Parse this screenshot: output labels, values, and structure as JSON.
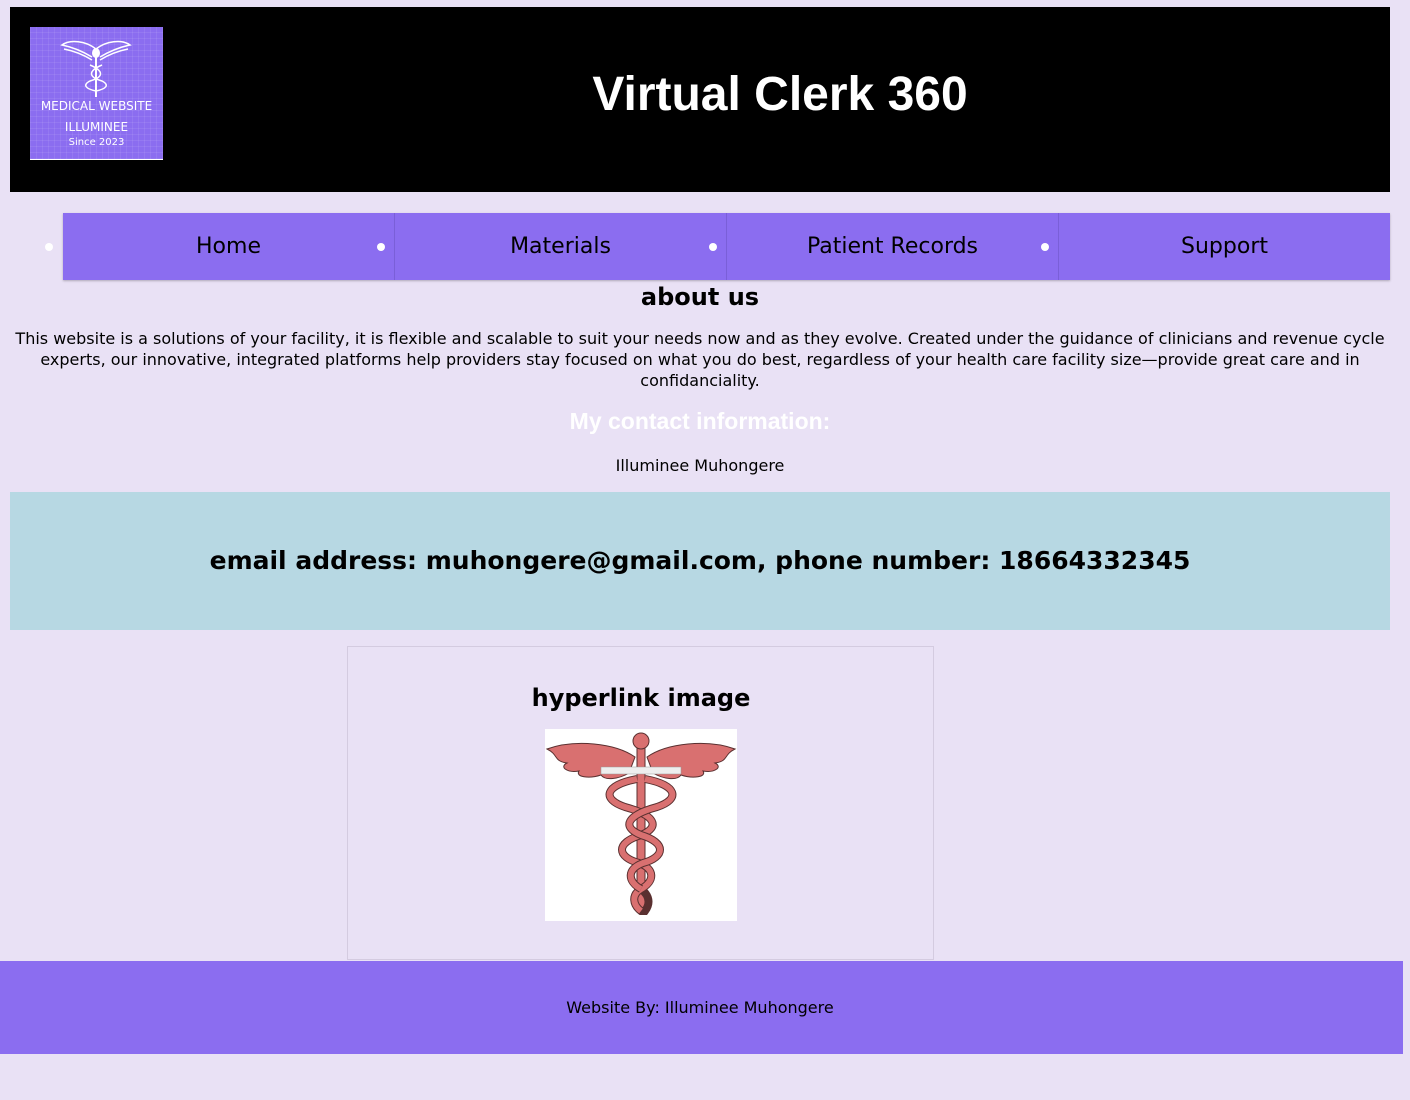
{
  "header": {
    "title": "Virtual Clerk 360",
    "logo": {
      "line1": "MEDICAL WEBSITE",
      "line2": "ILLUMINEE",
      "line3": "Since 2023",
      "icon": "caduceus-icon"
    }
  },
  "nav": {
    "items": [
      {
        "label": "Home"
      },
      {
        "label": "Materials"
      },
      {
        "label": "Patient Records"
      },
      {
        "label": "Support"
      }
    ]
  },
  "about": {
    "title": "about us",
    "text": "This website is a solutions of your facility, it is flexible and scalable to suit your needs now and as they evolve. Created under the guidance of clinicians and revenue cycle experts, our innovative, integrated platforms help providers stay focused on what you do best, regardless of your health care facility size—provide great care and in confidanciality."
  },
  "contact": {
    "title": "My contact information:",
    "name": "Illuminee Muhongere",
    "details": "email address: muhongere@gmail.com, phone number: 18664332345"
  },
  "card": {
    "title": "hyperlink image",
    "image": "caduceus-icon"
  },
  "footer": {
    "text": "Website By: Illuminee Muhongere"
  },
  "colors": {
    "page_background": "#e9e1f5",
    "header_background": "#000000",
    "accent_purple": "#8b6df0",
    "contact_box": "#b7d8e3",
    "caduceus_red": "#d97070"
  }
}
